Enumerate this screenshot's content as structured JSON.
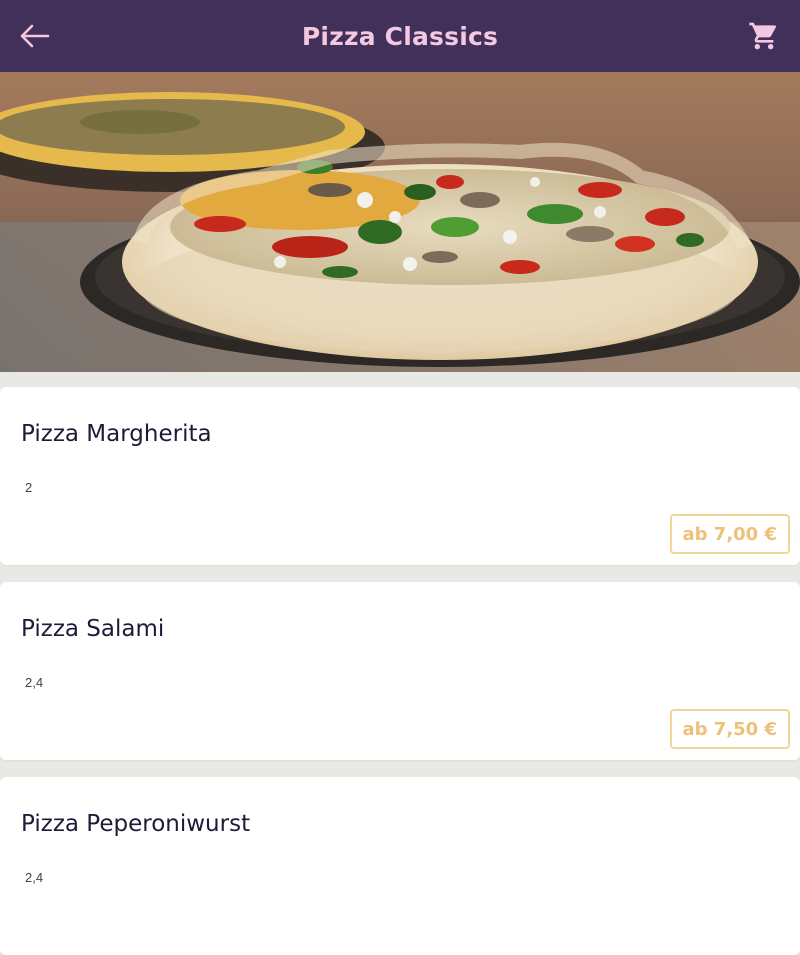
{
  "header": {
    "title": "Pizza Classics",
    "back_icon": "arrow-left-icon",
    "cart_icon": "cart-icon"
  },
  "colors": {
    "header_bg": "#40305a",
    "title": "#f4c8e0",
    "price_border": "#f3d597",
    "price_text": "#eec07a"
  },
  "menu": {
    "items": [
      {
        "name": "Pizza Margherita",
        "allergens": "2",
        "price": "ab 7,00 €"
      },
      {
        "name": "Pizza Salami",
        "allergens": "2,4",
        "price": "ab 7,50 €"
      },
      {
        "name": "Pizza Peperoniwurst",
        "allergens": "2,4",
        "price": ""
      }
    ]
  }
}
